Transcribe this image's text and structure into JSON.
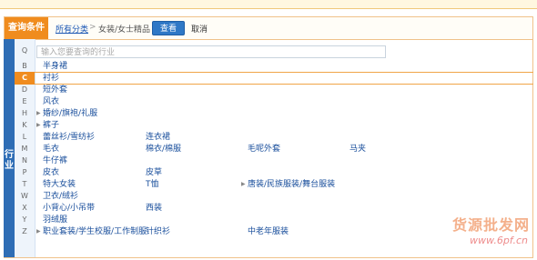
{
  "header": {
    "condition_title": "查询条件",
    "all_categories_link": "所有分类",
    "separator": ">",
    "current_category": "女装/女士精品",
    "view_button": "查看",
    "cancel_button": "取消"
  },
  "search": {
    "placeholder": "输入您要查询的行业"
  },
  "side_label": "行业",
  "letters": [
    "Q",
    "B",
    "C",
    "D",
    "E",
    "H",
    "K",
    "L",
    "M",
    "N",
    "P",
    "T",
    "W",
    "X",
    "Y",
    "Z"
  ],
  "active_letter": "C",
  "rows": [
    {
      "letter": "B",
      "items": [
        {
          "label": "半身裙"
        }
      ]
    },
    {
      "letter": "C",
      "items": [
        {
          "label": "衬衫"
        }
      ]
    },
    {
      "letter": "D",
      "items": [
        {
          "label": "短外套"
        }
      ]
    },
    {
      "letter": "E",
      "items": [
        {
          "label": "风衣"
        }
      ]
    },
    {
      "letter": "H",
      "items": [
        {
          "label": "婚纱/旗袍/礼服",
          "arrow": true
        }
      ]
    },
    {
      "letter": "K",
      "items": [
        {
          "label": "裤子",
          "arrow": true
        }
      ]
    },
    {
      "letter": "L",
      "items": [
        {
          "label": "蕾丝衫/雪纺衫"
        },
        {
          "label": "连衣裙"
        }
      ]
    },
    {
      "letter": "M",
      "items": [
        {
          "label": "毛衣"
        },
        {
          "label": "棉衣/棉服"
        },
        {
          "label": "毛呢外套"
        },
        {
          "label": "马夹"
        }
      ]
    },
    {
      "letter": "N",
      "items": [
        {
          "label": "牛仔裤"
        }
      ]
    },
    {
      "letter": "P",
      "items": [
        {
          "label": "皮衣"
        },
        {
          "label": "皮草"
        }
      ]
    },
    {
      "letter": "T",
      "items": [
        {
          "label": "特大女装"
        },
        {
          "label": "T恤"
        },
        {
          "label": "唐装/民族服装/舞台服装",
          "arrow": true
        }
      ]
    },
    {
      "letter": "W",
      "items": [
        {
          "label": "卫衣/绒衫"
        }
      ]
    },
    {
      "letter": "X",
      "items": [
        {
          "label": "小背心/小吊带"
        },
        {
          "label": "西装"
        }
      ]
    },
    {
      "letter": "Y",
      "items": [
        {
          "label": "羽绒服"
        }
      ]
    },
    {
      "letter": "Z",
      "items": [
        {
          "label": "职业套装/学生校服/工作制服",
          "arrow": true
        },
        {
          "label": "针织衫"
        },
        {
          "label": "中老年服装"
        }
      ]
    }
  ],
  "watermark": {
    "line1": "货源批发网",
    "line2": "www.6pf.cn"
  }
}
